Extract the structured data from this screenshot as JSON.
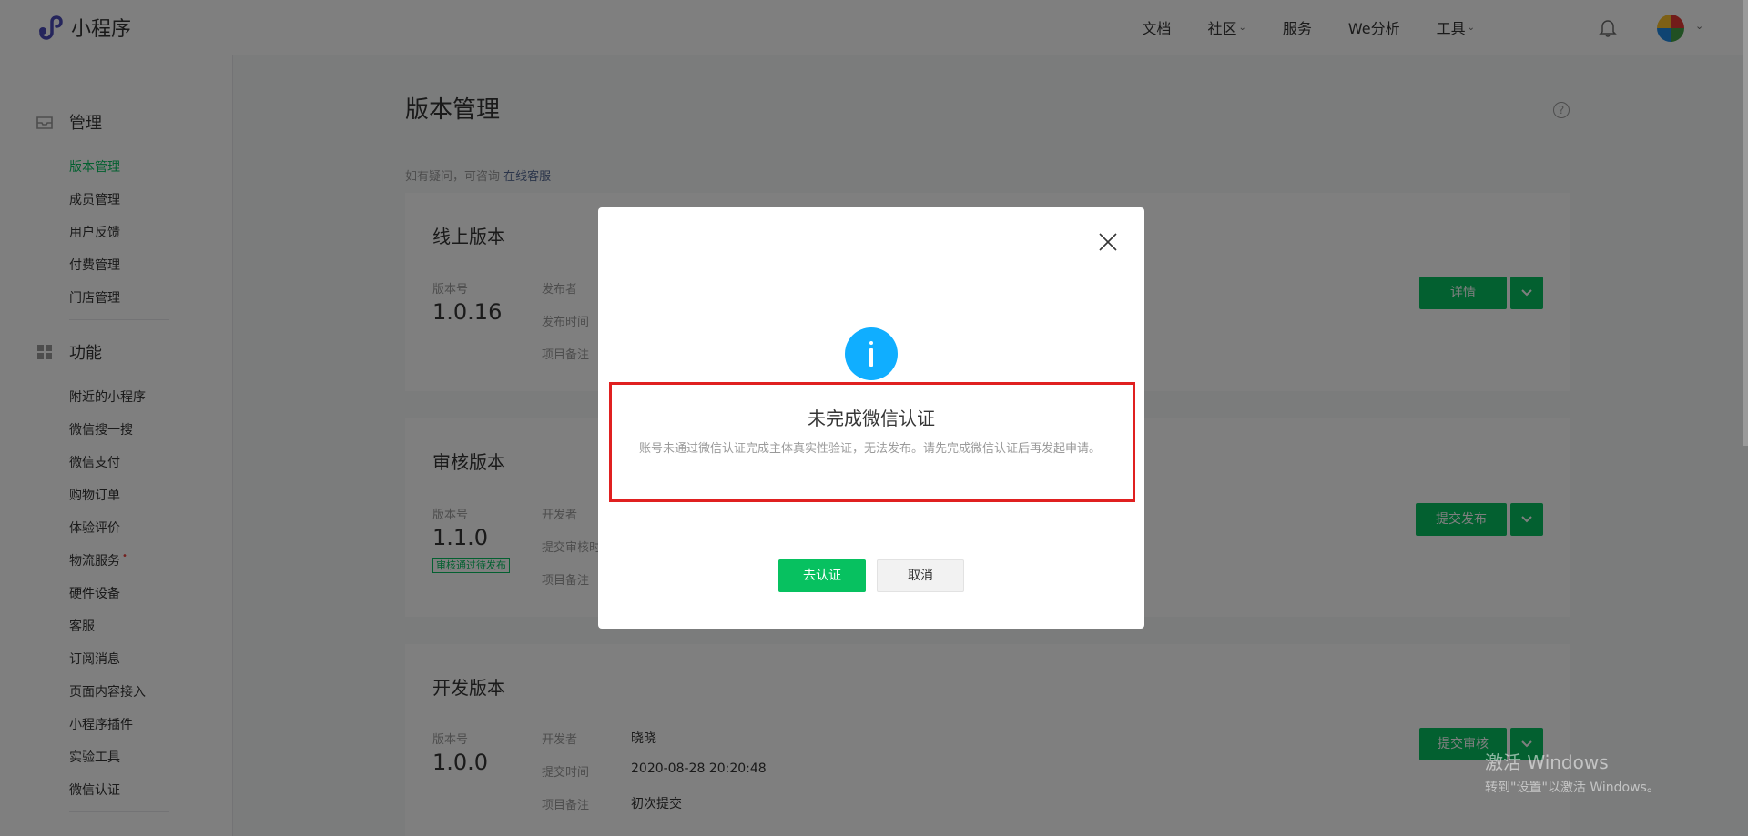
{
  "header": {
    "brand": "小程序",
    "nav": [
      {
        "label": "文档",
        "has_dropdown": false
      },
      {
        "label": "社区",
        "has_dropdown": true
      },
      {
        "label": "服务",
        "has_dropdown": false
      },
      {
        "label": "We分析",
        "has_dropdown": false
      },
      {
        "label": "工具",
        "has_dropdown": true
      }
    ],
    "chevron": "⌄"
  },
  "sidebar": {
    "manage_title": "管理",
    "manage_items": [
      "版本管理",
      "成员管理",
      "用户反馈",
      "付费管理",
      "门店管理"
    ],
    "feature_title": "功能",
    "feature_items": [
      "附近的小程序",
      "微信搜一搜",
      "微信支付",
      "购物订单",
      "体验评价",
      "物流服务",
      "硬件设备",
      "客服",
      "订阅消息",
      "页面内容接入",
      "小程序插件",
      "实验工具",
      "微信认证"
    ],
    "dot": "•"
  },
  "main": {
    "title": "版本管理",
    "help": "?",
    "hint": "如有疑问，可咨询",
    "hint_link": "在线客服",
    "online": {
      "title": "线上版本",
      "version_label": "版本号",
      "version": "1.0.16",
      "publisher_label": "发布者",
      "time_label": "发布时间",
      "note_label": "项目备注",
      "button": "详情"
    },
    "review": {
      "title": "审核版本",
      "version_label": "版本号",
      "version": "1.1.0",
      "badge": "审核通过待发布",
      "dev_label": "开发者",
      "time_label": "提交审核时",
      "note_label": "项目备注",
      "button": "提交发布"
    },
    "dev": {
      "title": "开发版本",
      "version_label": "版本号",
      "version": "1.0.0",
      "dev_label": "开发者",
      "developer": "晓晓",
      "time_label": "提交时间",
      "time": "2020-08-28 20:20:48",
      "note_label": "项目备注",
      "note": "初次提交",
      "button": "提交审核"
    }
  },
  "dialog": {
    "title": "未完成微信认证",
    "description": "账号未通过微信认证完成主体真实性验证，无法发布。请先完成微信认证后再发起申请。",
    "confirm": "去认证",
    "cancel": "取消"
  },
  "watermark": {
    "line1": "激活 Windows",
    "line2": "转到\"设置\"以激活 Windows。"
  },
  "colors": {
    "accent": "#07c160",
    "info": "#10aeff",
    "highlight": "#e02020",
    "link": "#576b95"
  }
}
